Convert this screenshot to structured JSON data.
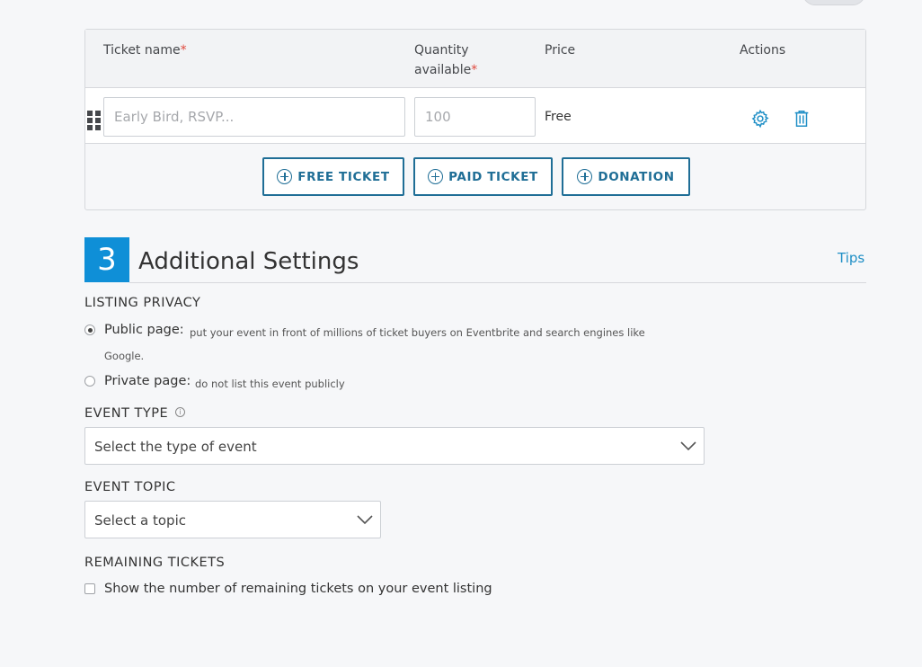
{
  "tickets": {
    "headers": {
      "name": "Ticket name",
      "quantity": "Quantity available",
      "price": "Price",
      "actions": "Actions",
      "required_mark": "*"
    },
    "row": {
      "name_placeholder": "Early Bird, RSVP...",
      "quantity_placeholder": "100",
      "price": "Free"
    },
    "buttons": {
      "free": "FREE TICKET",
      "paid": "PAID TICKET",
      "donation": "DONATION"
    }
  },
  "section": {
    "number": "3",
    "title": "Additional Settings",
    "tips": "Tips"
  },
  "privacy": {
    "label": "LISTING PRIVACY",
    "public_label": "Public page:",
    "public_desc": "put your event in front of millions of ticket buyers on Eventbrite and search engines like",
    "public_desc_cont": "Google.",
    "private_label": "Private page:",
    "private_desc": "do not list this event publicly",
    "selected": "public"
  },
  "event_type": {
    "label": "EVENT TYPE",
    "info_glyph": "i",
    "placeholder": "Select the type of event"
  },
  "event_topic": {
    "label": "EVENT TOPIC",
    "placeholder": "Select a topic"
  },
  "remaining": {
    "label": "REMAINING TICKETS",
    "checkbox_label": "Show the number of remaining tickets on your event listing",
    "checked": false
  },
  "colors": {
    "accent": "#1f6e96",
    "step_badge": "#0f8fd7",
    "link": "#1f8fc6",
    "required": "#e0483c"
  }
}
